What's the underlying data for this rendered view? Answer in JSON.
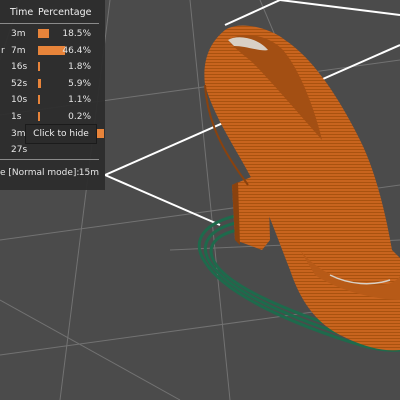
{
  "legend": {
    "header_time": "Time",
    "header_percentage": "Percentage",
    "rows": [
      {
        "edge": "",
        "time": "3m",
        "percentage": "18.5%",
        "fraction": 0.185,
        "color": "#e8843a"
      },
      {
        "edge": "r",
        "time": "7m",
        "percentage": "46.4%",
        "fraction": 0.464,
        "color": "#e8843a"
      },
      {
        "edge": "",
        "time": "16s",
        "percentage": "1.8%",
        "fraction": 0.018,
        "color": "#e8843a"
      },
      {
        "edge": "",
        "time": "52s",
        "percentage": "5.9%",
        "fraction": 0.059,
        "color": "#e8843a"
      },
      {
        "edge": "",
        "time": "10s",
        "percentage": "1.1%",
        "fraction": 0.011,
        "color": "#e8843a"
      },
      {
        "edge": "",
        "time": "1s",
        "percentage": "0.2%",
        "fraction": 0.002,
        "color": "#e8843a"
      },
      {
        "edge": "",
        "time": "3m",
        "percentage": "",
        "fraction": 0.17,
        "color": "#e8843a"
      },
      {
        "edge": "",
        "time": "27s",
        "percentage": "",
        "fraction": 0.0,
        "color": "#e8843a"
      }
    ],
    "tooltip": "Click to hide",
    "estimate_label": "e [Normal mode]:",
    "estimate_value": "15m"
  },
  "scene": {
    "background": "#4b4b4b",
    "grid_color": "#6e6e6e",
    "grid_major_color": "#ffffff",
    "model_color": "#c9651f",
    "model_dark": "#9a4a12",
    "skirt_color": "#1f6b4e"
  }
}
